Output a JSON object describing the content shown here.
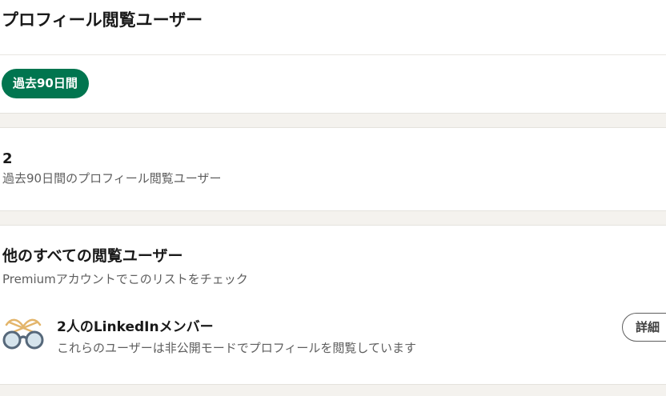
{
  "header": {
    "title": "プロフィール閲覧ユーザー"
  },
  "filter": {
    "label": "過去90日間"
  },
  "stats": {
    "count": "2",
    "description": "過去90日間のプロフィール閲覧ユーザー"
  },
  "others": {
    "title": "他のすべての閲覧ユーザー",
    "subtitle": "Premiumアカウントでこのリストをチェック",
    "private_viewers": {
      "icon": "glasses-icon",
      "title": "2人のLinkedInメンバー",
      "description": "これらのユーザーは非公開モードでプロフィールを閲覧しています",
      "button_label": "詳細"
    }
  },
  "colors": {
    "accent": "#01754f",
    "background_gap": "#f4f2ee",
    "secondary_text": "#5e5e5e"
  }
}
